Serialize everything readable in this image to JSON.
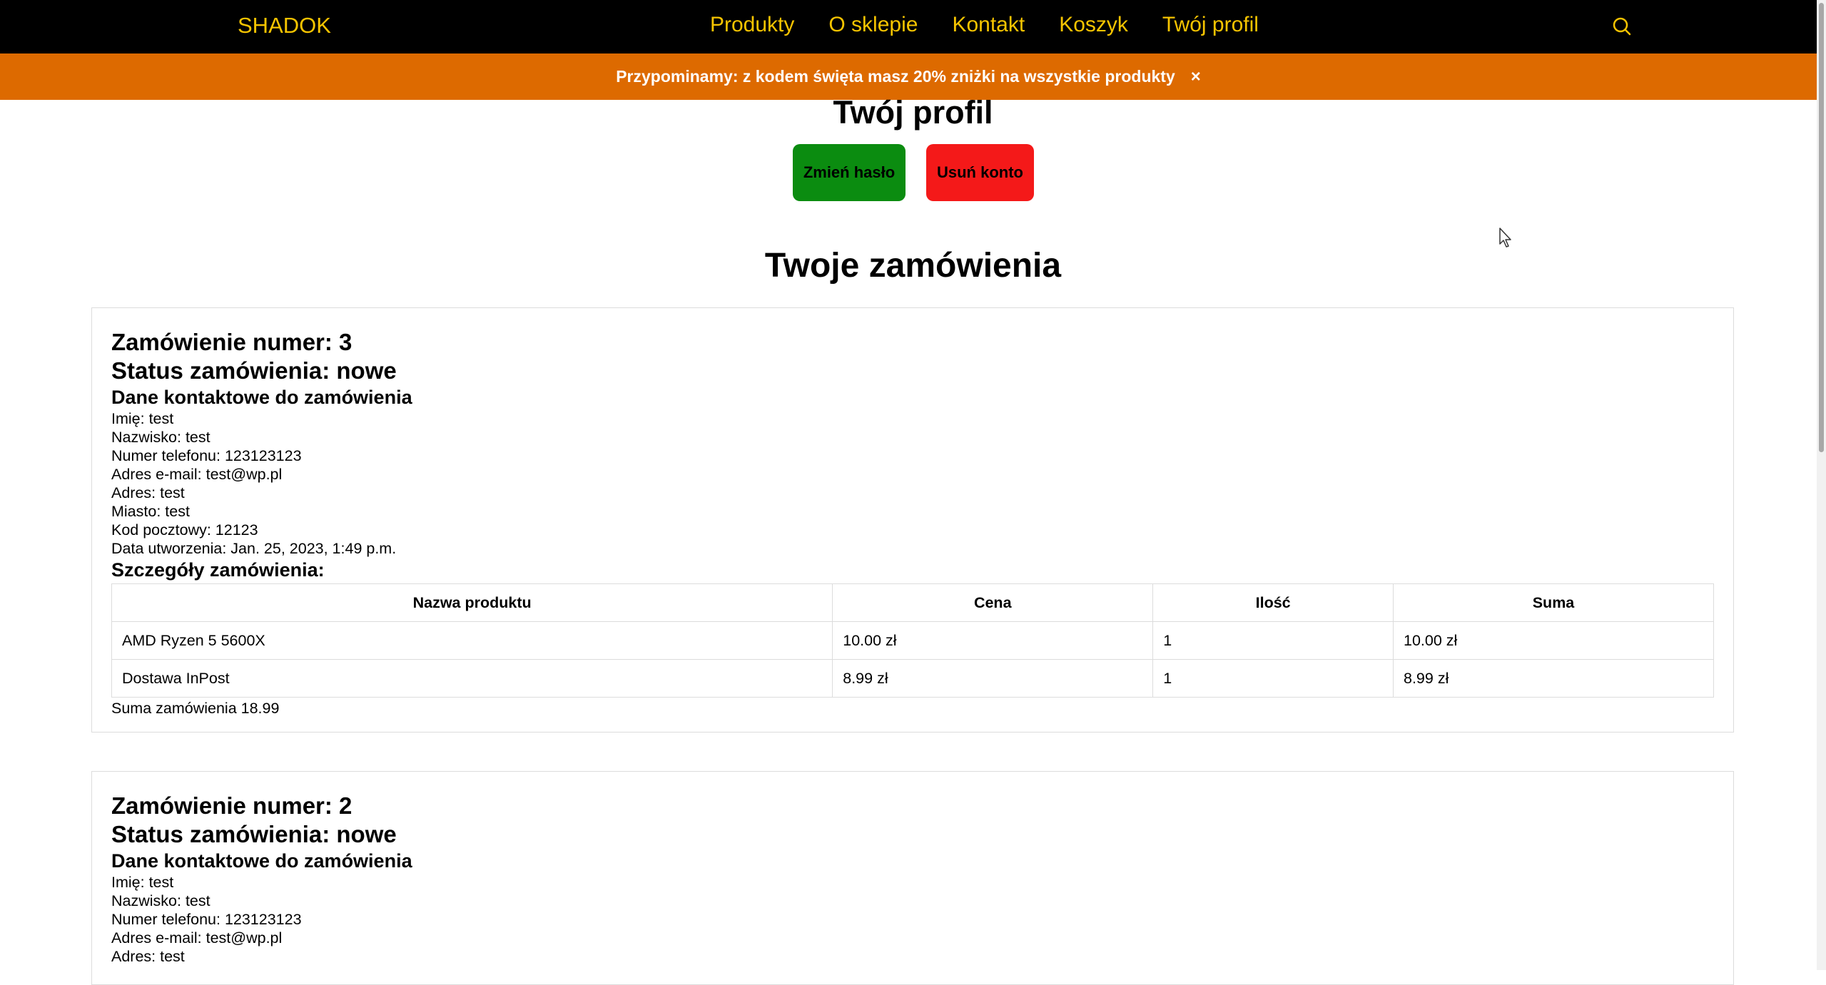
{
  "nav": {
    "brand": "SHADOK",
    "links": [
      "Produkty",
      "O sklepie",
      "Kontakt",
      "Koszyk",
      "Twój profil"
    ],
    "search_icon": "search-icon"
  },
  "promo": {
    "text": "Przypominamy: z kodem święta masz 20% zniżki na wszystkie produkty",
    "close": "×"
  },
  "profile": {
    "title": "Twój profil",
    "change_password": "Zmień hasło",
    "delete_account": "Usuń konto"
  },
  "orders_title": "Twoje zamówienia",
  "orders": [
    {
      "number_label": "Zamówienie numer: 3",
      "status_label": "Status zamówienia: nowe",
      "contact_header": "Dane kontaktowe do zamówienia",
      "lines": [
        "Imię: test",
        "Nazwisko: test",
        "Numer telefonu: 123123123",
        "Adres e-mail: test@wp.pl",
        "Adres: test",
        "Miasto: test",
        "Kod pocztowy: 12123",
        "Data utworzenia: Jan. 25, 2023, 1:49 p.m."
      ],
      "details_header": "Szczegóły zamówienia:",
      "table": {
        "headers": [
          "Nazwa produktu",
          "Cena",
          "Ilość",
          "Suma"
        ],
        "rows": [
          [
            "AMD Ryzen 5 5600X",
            "10.00 zł",
            "1",
            "10.00 zł"
          ],
          [
            "Dostawa InPost",
            "8.99 zł",
            "1",
            "8.99 zł"
          ]
        ]
      },
      "total": "Suma zamówienia 18.99"
    },
    {
      "number_label": "Zamówienie numer: 2",
      "status_label": "Status zamówienia: nowe",
      "contact_header": "Dane kontaktowe do zamówienia",
      "lines": [
        "Imię: test",
        "Nazwisko: test",
        "Numer telefonu: 123123123",
        "Adres e-mail: test@wp.pl",
        "Adres: test"
      ]
    }
  ],
  "colors": {
    "navbar": "#000000",
    "brand": "#f6c400",
    "promo": "#dd6a00",
    "change_password": "#0b8c10",
    "delete_account": "#f41919"
  }
}
